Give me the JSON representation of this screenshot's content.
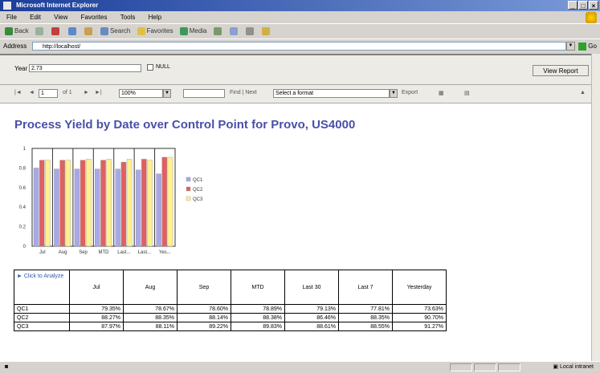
{
  "window": {
    "title": "Microsoft Internet Explorer"
  },
  "menu": [
    "File",
    "Edit",
    "View",
    "Favorites",
    "Tools",
    "Help"
  ],
  "toolbar": {
    "back": "Back",
    "search": "Search",
    "favorites": "Favorites",
    "media": "Media"
  },
  "address": {
    "label": "Address",
    "value": "http://localhost/",
    "go": "Go"
  },
  "params": {
    "label": "Year",
    "value": "2.73",
    "null_label": "NULL",
    "view_report": "View Report"
  },
  "report_toolbar": {
    "page": "1",
    "of_label": "of 1",
    "zoom": "100%",
    "find_next": "Find | Next",
    "format_placeholder": "Select a format",
    "export": "Export"
  },
  "report": {
    "title": "Process Yield by Date over Control Point for Provo, US4000"
  },
  "chart_data": {
    "type": "bar",
    "categories": [
      "Jul",
      "Aug",
      "Sep",
      "MTD",
      "Last...",
      "Last...",
      "Yes..."
    ],
    "series": [
      {
        "name": "QC1",
        "color": "#a8a8e8",
        "values": [
          0.8,
          0.79,
          0.79,
          0.79,
          0.79,
          0.78,
          0.74
        ]
      },
      {
        "name": "QC2",
        "color": "#e06060",
        "values": [
          0.88,
          0.88,
          0.88,
          0.88,
          0.86,
          0.89,
          0.91
        ]
      },
      {
        "name": "QC3",
        "color": "#fff090",
        "values": [
          0.88,
          0.88,
          0.89,
          0.89,
          0.89,
          0.88,
          0.91
        ]
      }
    ],
    "yticks": [
      "0",
      "0.2",
      "0.4",
      "0.6",
      "0.8",
      "1"
    ],
    "ylim": [
      0,
      1
    ]
  },
  "table": {
    "corner_label": "Click to Analyze",
    "columns": [
      "Jul",
      "Aug",
      "Sep",
      "MTD",
      "Last 30",
      "Last 7",
      "Yesterday"
    ],
    "rows": [
      {
        "label": "QC1",
        "values": [
          "79.35%",
          "78.67%",
          "78.60%",
          "78.89%",
          "79.13%",
          "77.81%",
          "73.63%"
        ]
      },
      {
        "label": "QC2",
        "values": [
          "88.27%",
          "88.35%",
          "88.14%",
          "88.38%",
          "86.46%",
          "88.35%",
          "90.70%"
        ]
      },
      {
        "label": "QC3",
        "values": [
          "87.97%",
          "88.11%",
          "89.22%",
          "89.83%",
          "88.61%",
          "88.55%",
          "91.27%"
        ]
      }
    ]
  },
  "status": {
    "zone": "Local intranet"
  }
}
